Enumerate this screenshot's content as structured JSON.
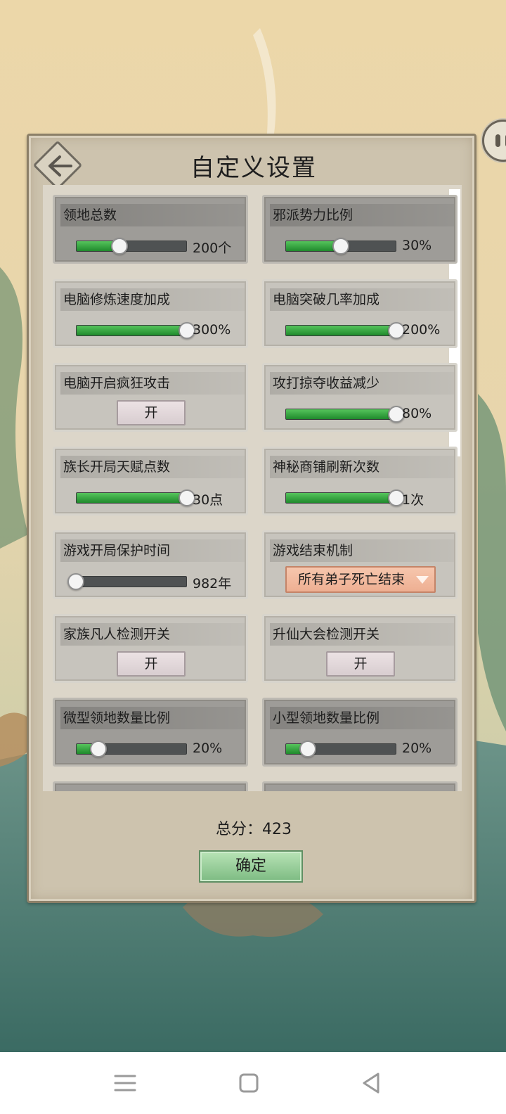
{
  "title": "自定义设置",
  "settings": [
    {
      "label": "领地总数",
      "kind": "slider",
      "value_text": "200个",
      "fraction": 0.39,
      "dark": true
    },
    {
      "label": "邪派势力比例",
      "kind": "slider",
      "value_text": "30%",
      "fraction": 0.5,
      "dark": true
    },
    {
      "label": "电脑修炼速度加成",
      "kind": "slider",
      "value_text": "300%",
      "fraction": 1.0,
      "dark": false
    },
    {
      "label": "电脑突破几率加成",
      "kind": "slider",
      "value_text": "200%",
      "fraction": 1.0,
      "dark": false
    },
    {
      "label": "电脑开启疯狂攻击",
      "kind": "toggle",
      "value_text": "开",
      "dark": false
    },
    {
      "label": "攻打掠夺收益减少",
      "kind": "slider",
      "value_text": "80%",
      "fraction": 1.0,
      "dark": false
    },
    {
      "label": "族长开局天赋点数",
      "kind": "slider",
      "value_text": "30点",
      "fraction": 1.0,
      "dark": false
    },
    {
      "label": "神秘商铺刷新次数",
      "kind": "slider",
      "value_text": "1次",
      "fraction": 1.0,
      "dark": false
    },
    {
      "label": "游戏开局保护时间",
      "kind": "slider",
      "value_text": "982年",
      "fraction": 0.0,
      "dark": false
    },
    {
      "label": "游戏结束机制",
      "kind": "dropdown",
      "value_text": "所有弟子死亡结束",
      "dark": false
    },
    {
      "label": "家族凡人检测开关",
      "kind": "toggle",
      "value_text": "开",
      "dark": false
    },
    {
      "label": "升仙大会检测开关",
      "kind": "toggle",
      "value_text": "开",
      "dark": false
    },
    {
      "label": "微型领地数量比例",
      "kind": "slider",
      "value_text": "20%",
      "fraction": 0.2,
      "dark": true
    },
    {
      "label": "小型领地数量比例",
      "kind": "slider",
      "value_text": "20%",
      "fraction": 0.2,
      "dark": true
    }
  ],
  "total": "总分：423",
  "confirm": "确定",
  "icons": {
    "back": "back-arrow-icon",
    "side": "robot-face-icon",
    "nav": [
      "menu-icon",
      "home-square-icon",
      "back-triangle-icon"
    ]
  },
  "colors": {
    "slider_fill": "#2e9e3a",
    "panel": "#cdc3ae",
    "confirm": "#9fd39f",
    "dropdown": "#f2b89c"
  }
}
